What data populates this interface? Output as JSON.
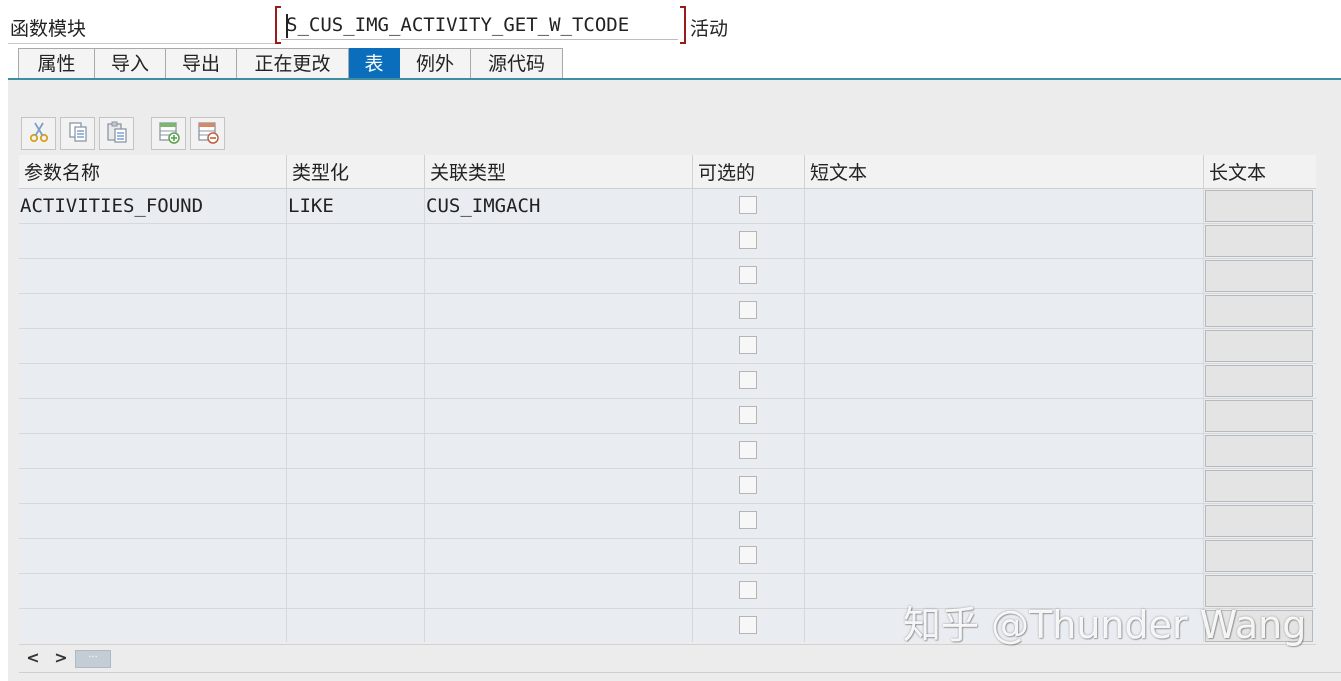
{
  "header": {
    "function_module_label": "函数模块",
    "function_module_value": "S_CUS_IMG_ACTIVITY_GET_W_TCODE",
    "status": "活动"
  },
  "tabs": [
    {
      "label": "属性",
      "active": false
    },
    {
      "label": "导入",
      "active": false
    },
    {
      "label": "导出",
      "active": false
    },
    {
      "label": "正在更改",
      "active": false
    },
    {
      "label": "表",
      "active": true
    },
    {
      "label": "例外",
      "active": false
    },
    {
      "label": "源代码",
      "active": false
    }
  ],
  "toolbar": {
    "buttons": [
      {
        "icon": "cut-icon"
      },
      {
        "icon": "copy-icon"
      },
      {
        "icon": "paste-icon"
      },
      {
        "icon": "insert-row-icon"
      },
      {
        "icon": "delete-row-icon"
      }
    ]
  },
  "table": {
    "columns": [
      "参数名称",
      "类型化",
      "关联类型",
      "可选的",
      "短文本",
      "长文本"
    ],
    "rows": [
      {
        "param": "ACTIVITIES_FOUND",
        "typing": "LIKE",
        "ref_type": "CUS_IMGACH",
        "optional": false,
        "short_text": ""
      }
    ],
    "total_visible_rows": 13
  },
  "scrollbar": {
    "left_label": "<",
    "right_label": ">",
    "thumb_label": "···"
  },
  "watermark": "知乎 @Thunder Wang",
  "colors": {
    "active_tab": "#0a6ebd",
    "focus_bracket": "#9a1b1b",
    "table_bg": "#e9edf1"
  }
}
